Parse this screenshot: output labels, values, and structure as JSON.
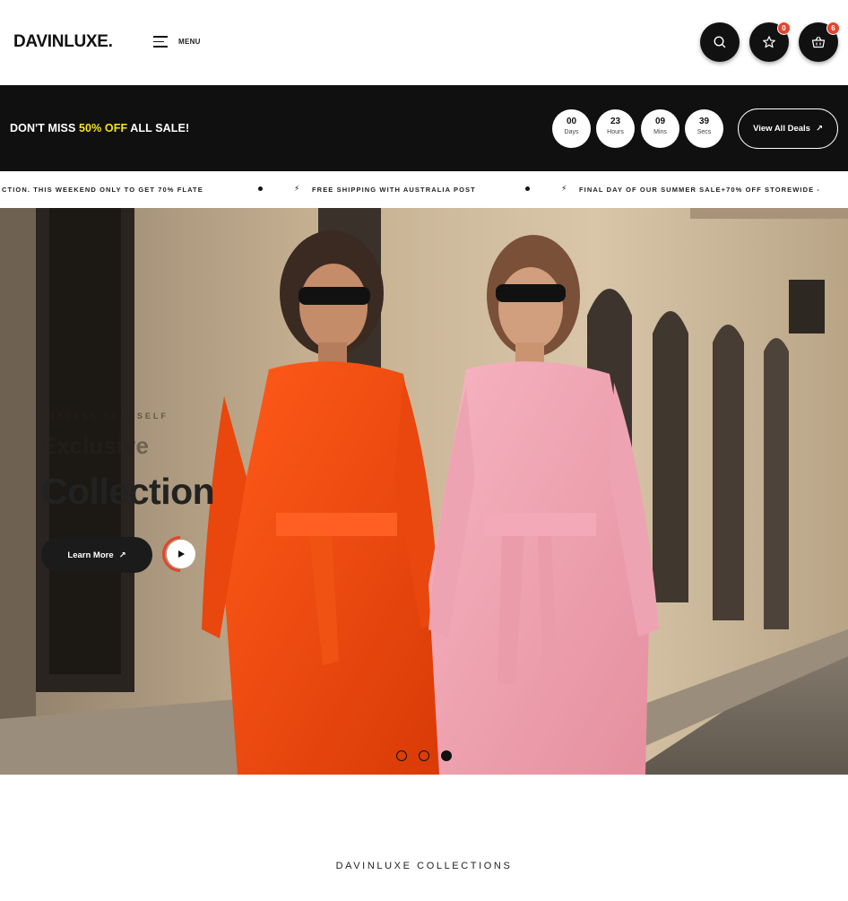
{
  "header": {
    "logo": "DAVINLUXE.",
    "menu_label": "MENU",
    "wishlist_count": "0",
    "cart_count": "6"
  },
  "salebar": {
    "text_before": "DON'T MISS ",
    "highlight": "50% OFF",
    "text_after": " ALL SALE!",
    "countdown": [
      {
        "value": "00",
        "unit": "Days"
      },
      {
        "value": "23",
        "unit": "Hours"
      },
      {
        "value": "09",
        "unit": "Mins"
      },
      {
        "value": "39",
        "unit": "Secs"
      }
    ],
    "deals_button": "View All Deals"
  },
  "ticker": {
    "items": [
      "CTION. THIS WEEKEND ONLY TO GET 70% FLATE",
      "FREE SHIPPING WITH AUSTRALIA POST",
      "FINAL DAY OF OUR SUMMER SALE+70% OFF STOREWIDE -"
    ]
  },
  "hero": {
    "eyebrow": "EXPRESS YOURSELF",
    "title_small": "Exclusive",
    "title_big": "Collection",
    "cta": "Learn More",
    "slides": 3,
    "active_slide": 3
  },
  "collections": {
    "heading": "DAVINLUXE COLLECTIONS"
  },
  "colors": {
    "accent": "#e4432d",
    "highlight": "#f5e120",
    "dark": "#101010"
  }
}
